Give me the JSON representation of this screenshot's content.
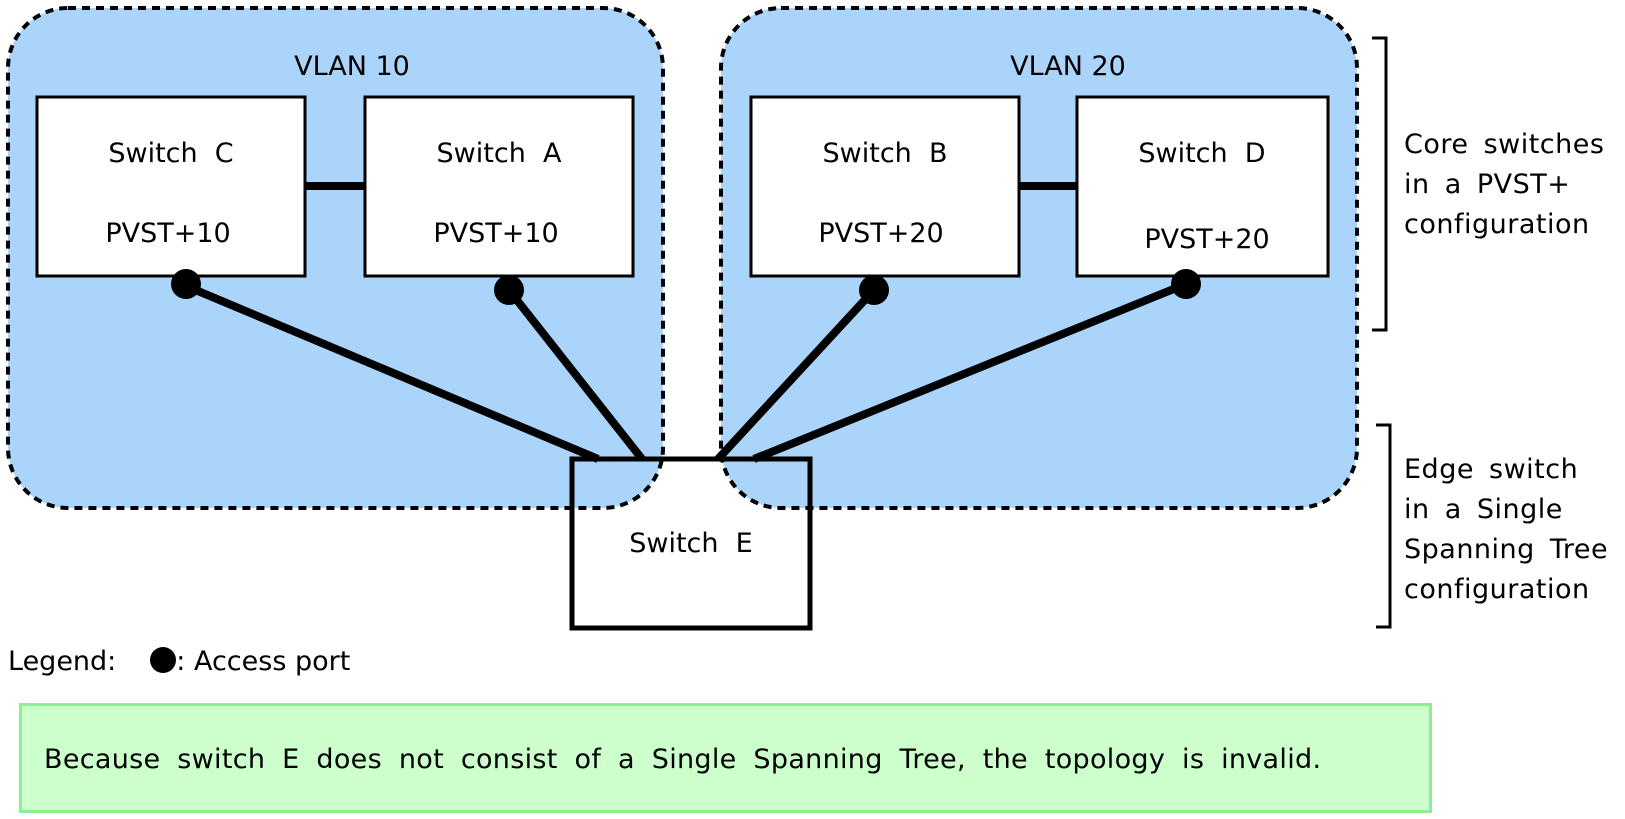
{
  "vlans": [
    {
      "id": "vlan10",
      "label": "VLAN 10"
    },
    {
      "id": "vlan20",
      "label": "VLAN 20"
    }
  ],
  "switches": [
    {
      "id": "C",
      "name": "Switch  C",
      "protocol": "PVST+10"
    },
    {
      "id": "A",
      "name": "Switch  A",
      "protocol": "PVST+10"
    },
    {
      "id": "B",
      "name": "Switch  B",
      "protocol": "PVST+20"
    },
    {
      "id": "D",
      "name": "Switch  D",
      "protocol": "PVST+20"
    },
    {
      "id": "E",
      "name": "Switch  E"
    }
  ],
  "links": [
    {
      "from": "C",
      "to": "A",
      "type": "trunk"
    },
    {
      "from": "B",
      "to": "D",
      "type": "trunk"
    },
    {
      "from": "C",
      "to": "E",
      "type": "access"
    },
    {
      "from": "A",
      "to": "E",
      "type": "access"
    },
    {
      "from": "B",
      "to": "E",
      "type": "access"
    },
    {
      "from": "D",
      "to": "E",
      "type": "access"
    }
  ],
  "annotations": {
    "core": [
      "Core switches",
      "in a PVST+",
      "configuration"
    ],
    "edge": [
      "Edge switch",
      "in a Single",
      "Spanning Tree",
      "configuration"
    ]
  },
  "legend": {
    "prefix": "Legend:",
    "item": ": Access port"
  },
  "result_text": "Because switch E does not consist of a Single Spanning Tree, the topology is invalid.",
  "colors": {
    "vlan_fill": "#aad4fa",
    "result_bg": "#ccffcc",
    "result_border": "#90ee90"
  }
}
